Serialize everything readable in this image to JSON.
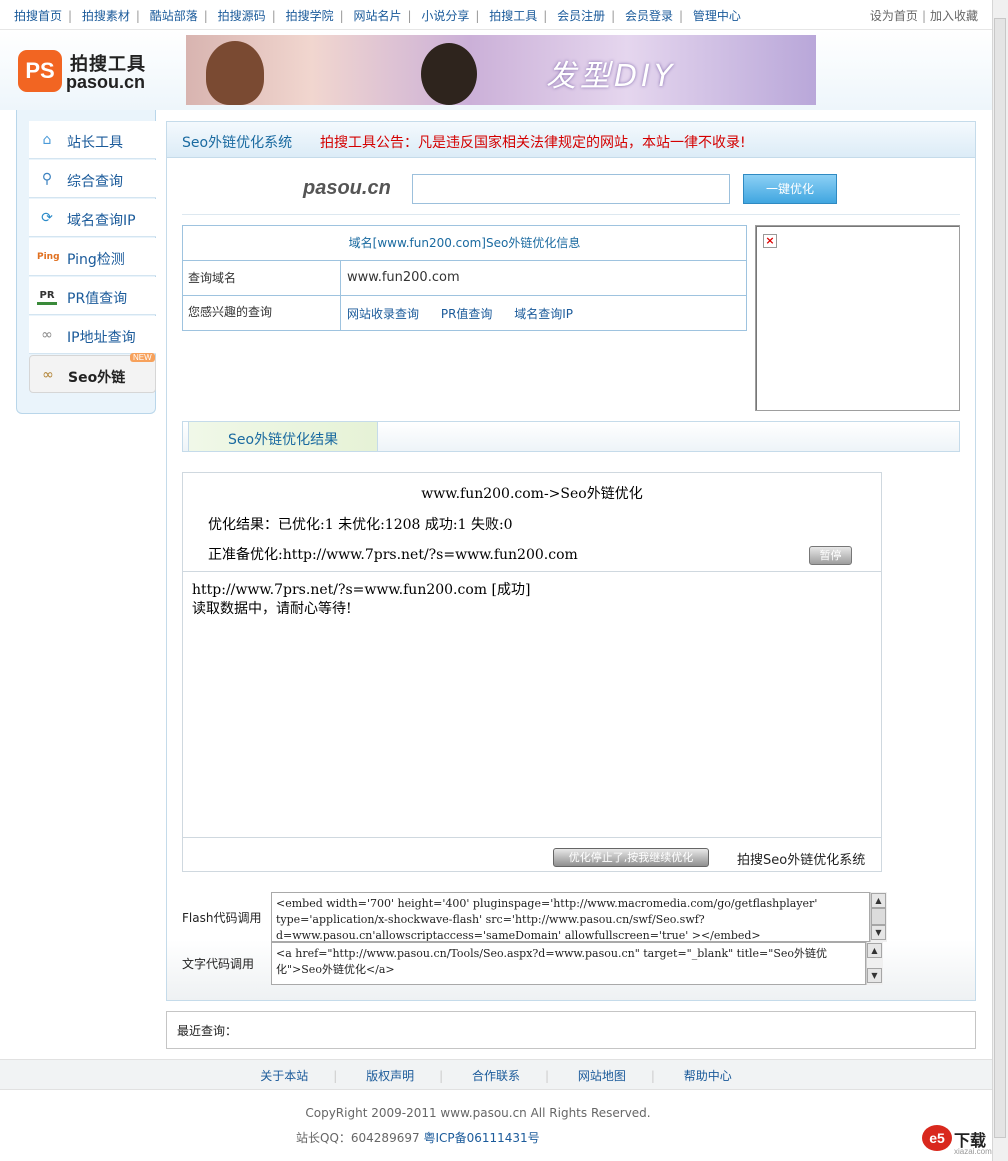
{
  "topnav": {
    "items": [
      "拍搜首页",
      "拍搜素材",
      "酷站部落",
      "拍搜源码",
      "拍搜学院",
      "网站名片",
      "小说分享",
      "拍搜工具",
      "会员注册",
      "会员登录",
      "管理中心"
    ],
    "right": [
      "设为首页",
      "加入收藏"
    ]
  },
  "header": {
    "logo_badge": "PS",
    "logo_cn": "拍搜工具",
    "logo_en": "pasou.cn",
    "banner_text": "发型DIY"
  },
  "sidebar": {
    "items": [
      {
        "label": "站长工具",
        "icon": "home-icon"
      },
      {
        "label": "综合查询",
        "icon": "magnifier-icon"
      },
      {
        "label": "域名查询IP",
        "icon": "refresh-globe-icon"
      },
      {
        "label": "Ping检测",
        "icon": "ping-icon"
      },
      {
        "label": "PR值查询",
        "icon": "pr-icon"
      },
      {
        "label": "IP地址查询",
        "icon": "chain-link-icon"
      },
      {
        "label": "Seo外链",
        "icon": "chain-link-icon"
      }
    ],
    "new_badge": "NEW"
  },
  "main": {
    "title": "Seo外链优化系统",
    "notice": "拍搜工具公告：凡是违反国家相关法律规定的网站，本站一律不收录!",
    "search_logo": "pasou.cn",
    "search_value": "",
    "search_button": "一键优化"
  },
  "info": {
    "title": "域名[www.fun200.com]Seo外链优化信息",
    "row_domain_label": "查询域名",
    "row_domain_value": "www.fun200.com",
    "row_interest_label": "您感兴趣的查询",
    "links": [
      "网站收录查询",
      "PR值查询",
      "域名查询IP"
    ]
  },
  "result": {
    "tab": "Seo外链优化结果",
    "title": "www.fun200.com->Seo外链优化",
    "summary": "优化结果：已优化:1 未优化:1208 成功:1 失败:0",
    "current": "正准备优化:http://www.7prs.net/?s=www.fun200.com",
    "pause_button": "暂停",
    "log_line1": "http://www.7prs.net/?s=www.fun200.com [成功]",
    "log_line2": "读取数据中，请耐心等待!",
    "resume_button": "优化停止了,按我继续优化",
    "brand": "拍搜Seo外链优化系统"
  },
  "code": {
    "flash_label": "Flash代码调用",
    "flash_line1": "<embed width='700' height='400' pluginspage='http://www.macromedia.com/go/getflashplayer'",
    "flash_line2": "type='application/x-shockwave-flash' src='http://www.pasou.cn/swf/Seo.swf?",
    "flash_line3": "d=www.pasou.cn'allowscriptaccess='sameDomain' allowfullscreen='true'  ></embed>",
    "text_label": "文字代码调用",
    "text_line1": "<a href=\"http://www.pasou.cn/Tools/Seo.aspx?d=www.pasou.cn\" target=\"_blank\" title=\"Seo外链优",
    "text_line2": "化\">Seo外链优化</a>"
  },
  "recent": {
    "label": "最近查询："
  },
  "footer": {
    "links": [
      "关于本站",
      "版权声明",
      "合作联系",
      "网站地图",
      "帮助中心"
    ],
    "copyright": "CopyRight 2009-2011 www.pasou.cn All Rights Reserved.",
    "qq": "站长QQ：604289697",
    "icp": "粤ICP备06111431号"
  },
  "watermark": {
    "logo": "e5",
    "text": "下载",
    "sub": "xiazai.com"
  }
}
